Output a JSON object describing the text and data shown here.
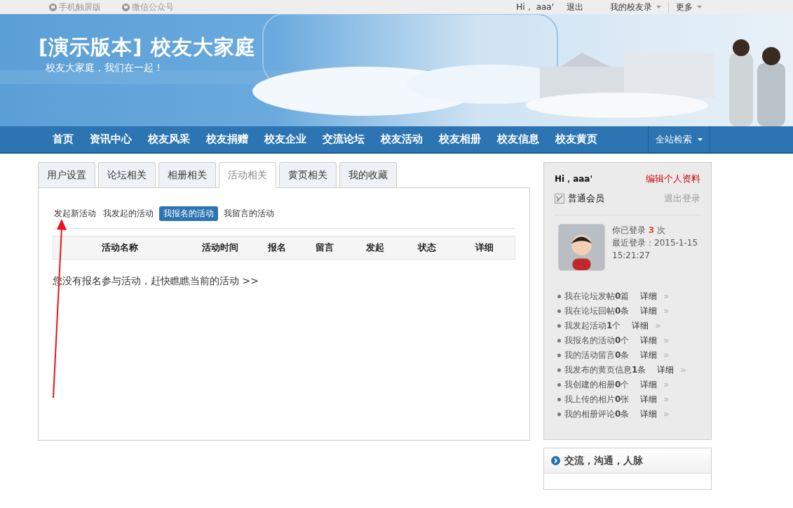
{
  "top_bar": {
    "links": [
      {
        "label": "手机触屏版"
      },
      {
        "label": "微信公众号"
      }
    ],
    "greeting": "Hi，",
    "user": "aaa'",
    "logout": "退出",
    "menus": [
      {
        "label": "我的校友录"
      },
      {
        "label": "更多"
      }
    ]
  },
  "banner": {
    "title": "[演示版本] 校友大家庭",
    "slogan": "校友大家庭，我们在一起！"
  },
  "nav": {
    "items": [
      {
        "label": "首页"
      },
      {
        "label": "资讯中心"
      },
      {
        "label": "校友风采"
      },
      {
        "label": "校友捐赠"
      },
      {
        "label": "校友企业"
      },
      {
        "label": "交流论坛"
      },
      {
        "label": "校友活动"
      },
      {
        "label": "校友相册"
      },
      {
        "label": "校友信息"
      },
      {
        "label": "校友黄页"
      }
    ],
    "search_menu": "全站检索"
  },
  "tabs": [
    {
      "label": "用户设置",
      "selected": false
    },
    {
      "label": "论坛相关",
      "selected": false
    },
    {
      "label": "相册相关",
      "selected": false
    },
    {
      "label": "活动相关",
      "selected": true
    },
    {
      "label": "黄页相关",
      "selected": false
    },
    {
      "label": "我的收藏",
      "selected": false
    }
  ],
  "subtabs": [
    {
      "label": "发起新活动",
      "selected": false
    },
    {
      "label": "我发起的活动",
      "selected": false
    },
    {
      "label": "我报名的活动",
      "selected": true
    },
    {
      "label": "我留言的活动",
      "selected": false
    }
  ],
  "table": {
    "columns": [
      "活动名称",
      "活动时间",
      "报名",
      "留言",
      "发起",
      "状态",
      "详细"
    ]
  },
  "empty_message": "您没有报名参与活动，赶快瞧瞧当前的活动 >>",
  "profile": {
    "greeting": "Hi，aaa'",
    "edit_link": "编辑个人资料",
    "level": "普通会员",
    "logout": "退出登录",
    "login_prefix": "你已登录",
    "login_count": "3",
    "login_suffix": "次",
    "last_login": "最近登录：2015-1-15 15:21:27"
  },
  "stats": [
    {
      "text": "我在论坛发帖**0**篇",
      "link": "详细"
    },
    {
      "text": "我在论坛回帖**0**条",
      "link": "详细"
    },
    {
      "text": "我发起活动**1**个",
      "link": "详细"
    },
    {
      "text": "我报名的活动**0**个",
      "link": "详细"
    },
    {
      "text": "我的活动留言**0**条",
      "link": "详细"
    },
    {
      "text": "我发布的黄页信息**1**条",
      "link": "详细"
    },
    {
      "text": "我创建的相册**0**个",
      "link": "详细"
    },
    {
      "text": "我上传的相片**0**张",
      "link": "详细"
    },
    {
      "text": "我的相册评论**0**条",
      "link": "详细"
    }
  ],
  "promo": {
    "title": "交流，沟通，人脉"
  }
}
